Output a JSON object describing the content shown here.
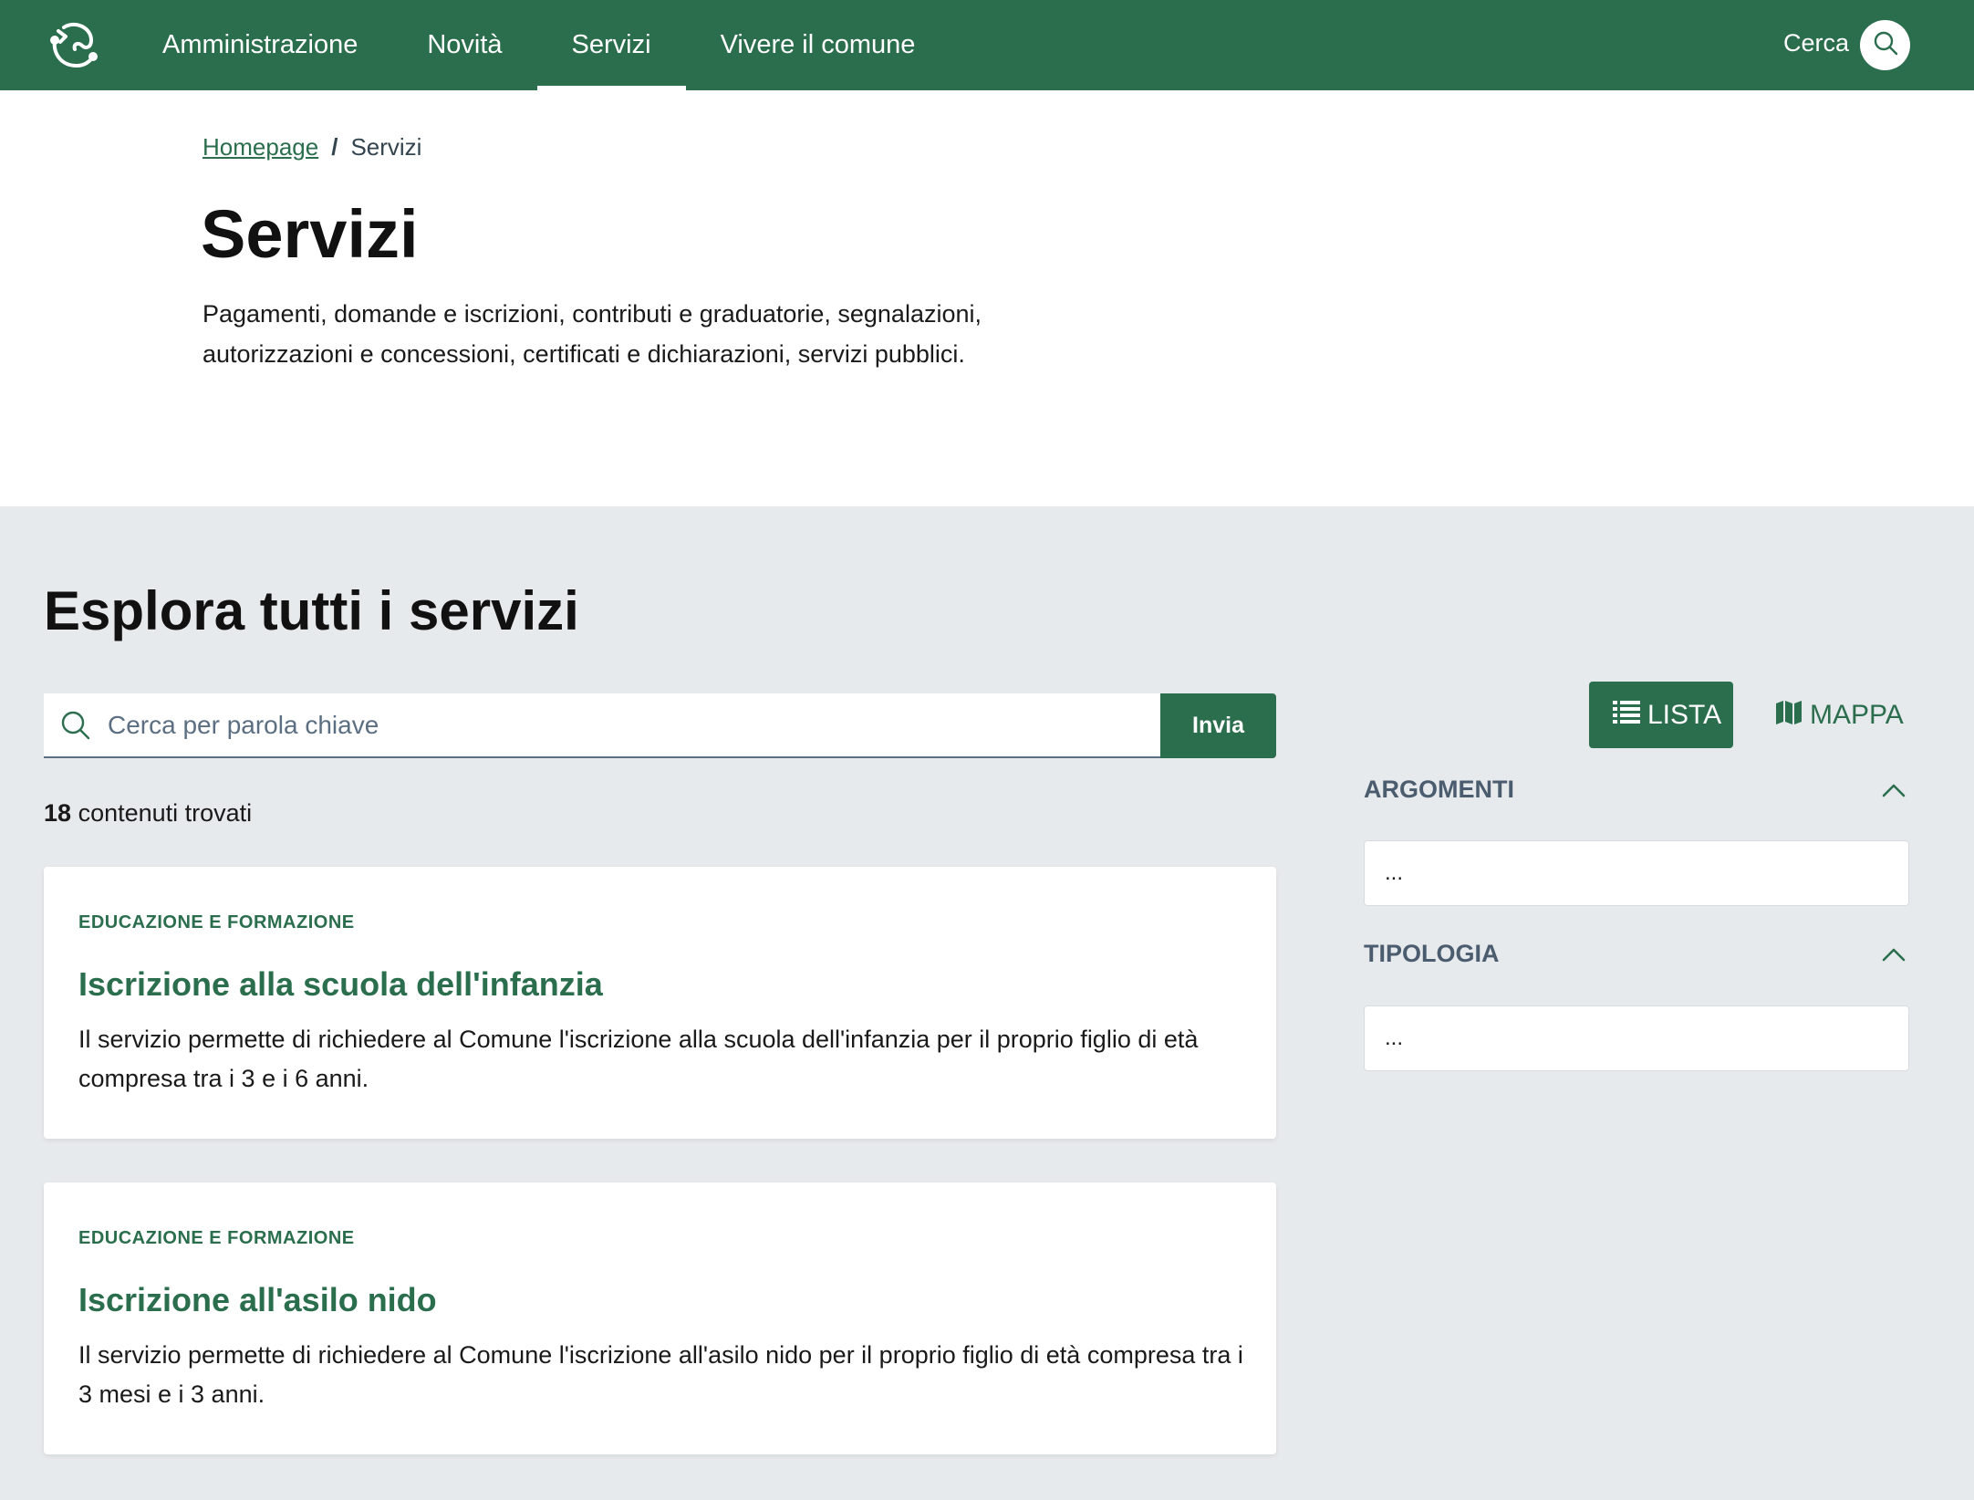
{
  "header": {
    "nav": [
      {
        "label": "Amministrazione"
      },
      {
        "label": "Novità"
      },
      {
        "label": "Servizi"
      },
      {
        "label": "Vivere il comune"
      }
    ],
    "search_label": "Cerca",
    "active_item": "Servizi"
  },
  "breadcrumb": {
    "home": "Homepage",
    "separator": "/",
    "current": "Servizi"
  },
  "page": {
    "title": "Servizi",
    "description": "Pagamenti, domande e iscrizioni, contributi e graduatorie, segnalazioni, autorizzazioni e concessioni, certificati e dichiarazioni, servizi pubblici."
  },
  "explore": {
    "title": "Esplora tutti i servizi",
    "search_placeholder": "Cerca per parola chiave",
    "submit_label": "Invia",
    "results_count": "18",
    "results_text": "contenuti trovati"
  },
  "cards": [
    {
      "category": "EDUCAZIONE E FORMAZIONE",
      "title": "Iscrizione alla scuola dell'infanzia",
      "description": "Il servizio permette di richiedere al Comune l'iscrizione alla scuola dell'infanzia per il proprio figlio di età compresa tra i 3 e i 6 anni."
    },
    {
      "category": "EDUCAZIONE E FORMAZIONE",
      "title": "Iscrizione all'asilo nido",
      "description": "Il servizio permette di richiedere al Comune l'iscrizione all'asilo nido per il proprio figlio di età compresa tra i 3 mesi e i 3 anni."
    }
  ],
  "view_toggle": {
    "list_label": "LISTA",
    "map_label": "MAPPA",
    "active": "LISTA"
  },
  "filters": [
    {
      "label": "ARGOMENTI",
      "value": "..."
    },
    {
      "label": "TIPOLOGIA",
      "value": "..."
    }
  ],
  "colors": {
    "brand": "#2b6e4d",
    "section_bg": "#e7eaed",
    "filter_label": "#4a5c6d"
  },
  "icons": [
    "logo-icon",
    "search-icon",
    "list-icon",
    "map-icon",
    "chevron-up-icon"
  ]
}
